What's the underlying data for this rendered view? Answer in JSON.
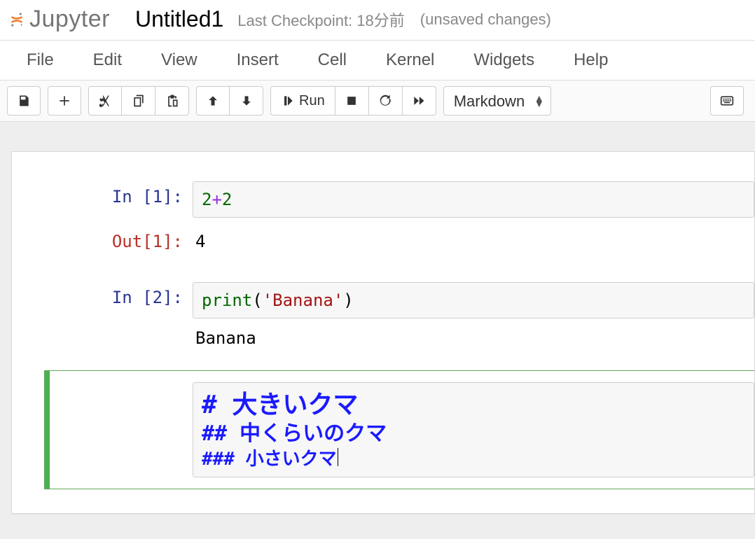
{
  "header": {
    "logo_text": "Jupyter",
    "notebook_title": "Untitled1",
    "checkpoint_text": "Last Checkpoint: 18分前",
    "unsaved_text": "(unsaved changes)"
  },
  "menu": {
    "items": [
      "File",
      "Edit",
      "View",
      "Insert",
      "Cell",
      "Kernel",
      "Widgets",
      "Help"
    ]
  },
  "toolbar": {
    "run_label": "Run",
    "celltype_selected": "Markdown"
  },
  "cells": [
    {
      "type": "code",
      "in_label": "In [1]:",
      "source_tokens": [
        {
          "t": "2",
          "cls": "tok-num"
        },
        {
          "t": "+",
          "cls": "tok-op"
        },
        {
          "t": "2",
          "cls": "tok-num"
        }
      ],
      "out_label": "Out[1]:",
      "out_value": "4"
    },
    {
      "type": "code",
      "in_label": "In [2]:",
      "source_tokens": [
        {
          "t": "print",
          "cls": "tok-fn"
        },
        {
          "t": "(",
          "cls": ""
        },
        {
          "t": "'Banana'",
          "cls": "tok-str"
        },
        {
          "t": ")",
          "cls": ""
        }
      ],
      "stream_output": "Banana"
    },
    {
      "type": "markdown_edit",
      "lines": [
        {
          "text": "# 大きいクマ",
          "cls": "md-l1"
        },
        {
          "text": "## 中くらいのクマ",
          "cls": "md-l2"
        },
        {
          "text": "### 小さいクマ",
          "cls": "md-l3",
          "caret": true
        }
      ]
    }
  ]
}
